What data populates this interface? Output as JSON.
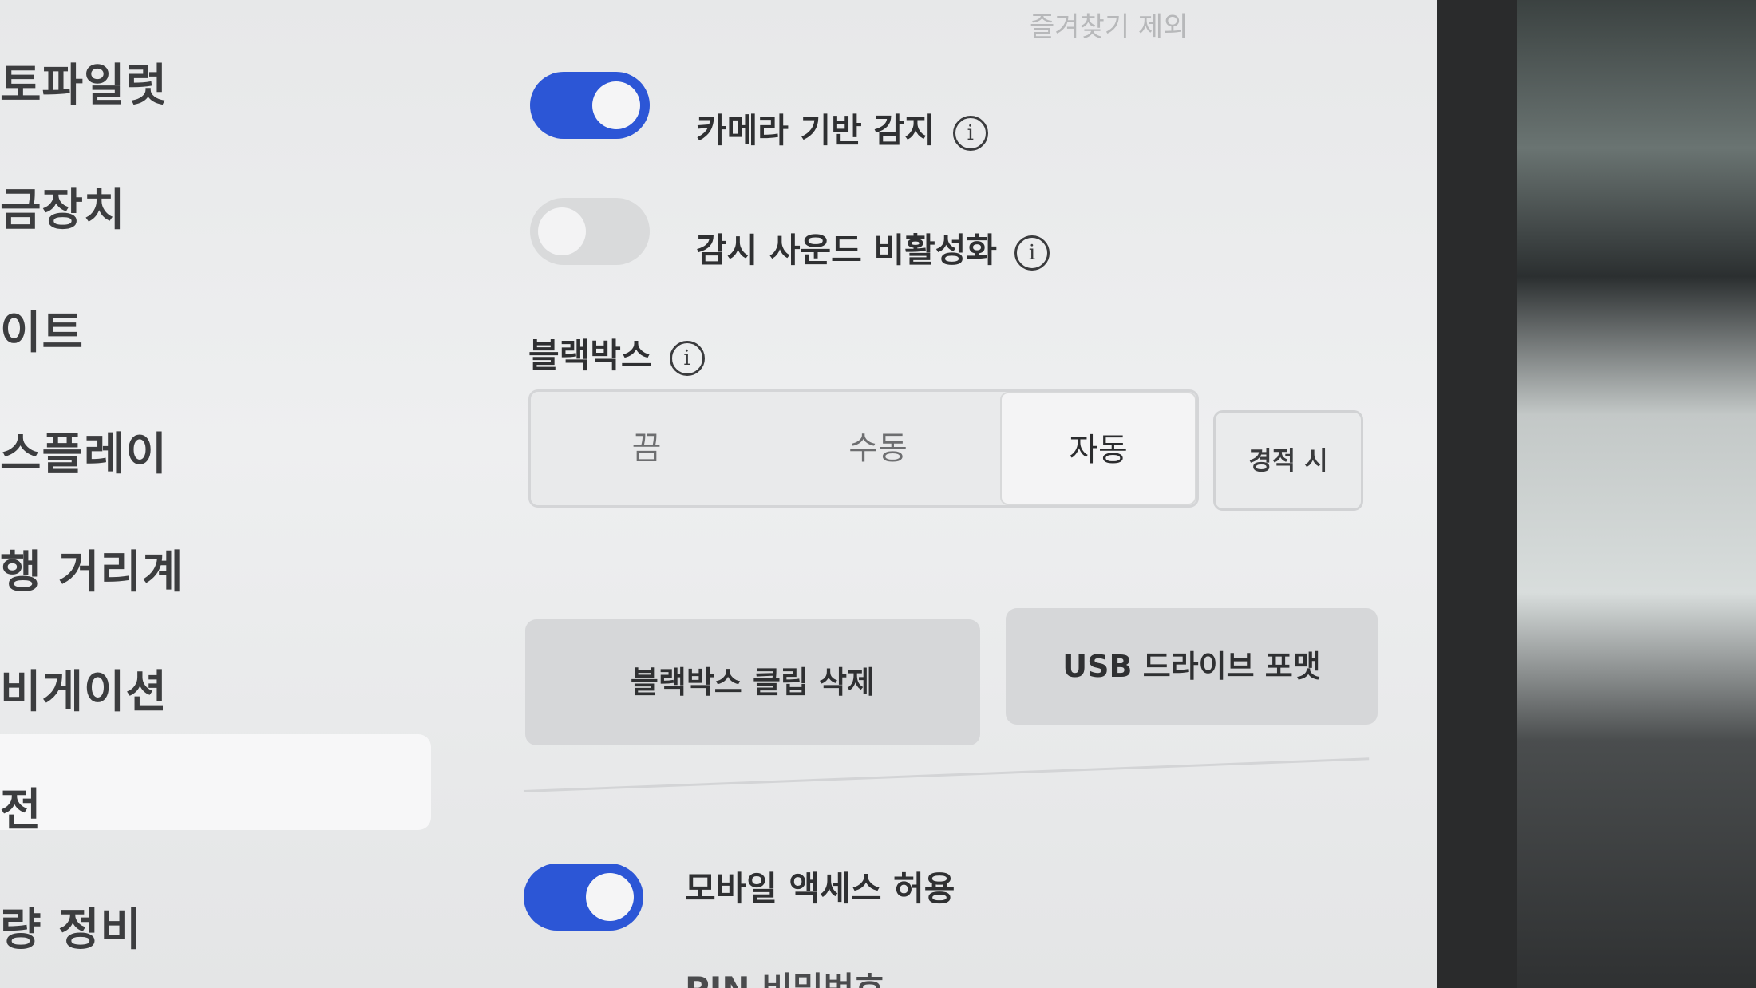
{
  "header": {
    "favorites_exclude": "즐겨찾기 제외"
  },
  "sidebar": {
    "items": [
      {
        "label": "토파일럿"
      },
      {
        "label": "금장치"
      },
      {
        "label": "이트"
      },
      {
        "label": "스플레이"
      },
      {
        "label": "행 거리계"
      },
      {
        "label": "비게이션"
      },
      {
        "label": "전",
        "selected": true
      },
      {
        "label": "량 정비"
      }
    ]
  },
  "settings": {
    "camera_detection": {
      "label": "카메라 기반 감지",
      "enabled": true,
      "info_icon": "info-icon"
    },
    "disable_sentry_sound": {
      "label": "감시 사운드 비활성화",
      "enabled": false,
      "info_icon": "info-icon"
    },
    "dashcam": {
      "title": "블랙박스",
      "info_icon": "info-icon",
      "options": [
        "끔",
        "수동",
        "자동"
      ],
      "selected": "자동",
      "on_honk": "경적 시"
    },
    "actions": {
      "delete_clips": "블랙박스 클립 삭제",
      "format_usb": "USB 드라이브 포맷"
    },
    "mobile_access": {
      "label": "모바일 액세스 허용",
      "enabled": true
    },
    "partial_next": "PIN 비밀번호"
  },
  "colors": {
    "toggle_on": "#2c56d6",
    "toggle_off": "#d9dadb",
    "background": "#eeeff0"
  }
}
